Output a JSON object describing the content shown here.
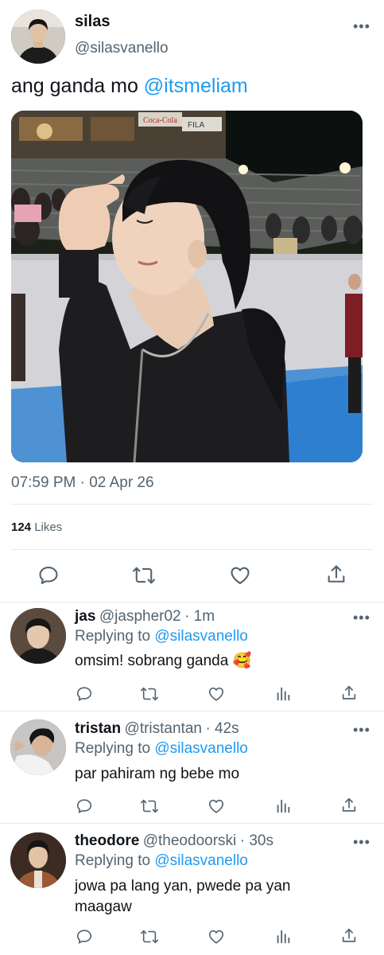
{
  "main_tweet": {
    "name": "silas",
    "handle": "@silasvanello",
    "text_prefix": "ang ganda mo ",
    "mention": "@itsmeliam",
    "time": "07:59 PM · 02 Apr 26",
    "likes_count": "124",
    "likes_label": "Likes",
    "photo_signs": {
      "sign_a": "Coca-Cola",
      "sign_b": "FILA"
    }
  },
  "replies": [
    {
      "name": "jas",
      "handle": "@jaspher02",
      "time": "· 1m",
      "replying_label": "Replying to ",
      "replying_to": "@silasvanello",
      "text": "omsim! sobrang ganda",
      "emoji": "🥰"
    },
    {
      "name": "tristan",
      "handle": "@tristantan",
      "time": "· 42s",
      "replying_label": "Replying to ",
      "replying_to": "@silasvanello",
      "text": "par pahiram ng bebe mo"
    },
    {
      "name": "theodore",
      "handle": "@theodoorski",
      "time": "· 30s",
      "replying_label": "Replying to ",
      "replying_to": "@silasvanello",
      "text_line1": "jowa pa lang yan, pwede pa yan",
      "text_line2": "maagaw"
    }
  ],
  "icons": {
    "reply": "reply-icon",
    "retweet": "retweet-icon",
    "like": "like-icon",
    "share": "share-icon",
    "analytics": "analytics-icon",
    "more": "more-icon"
  },
  "colors": {
    "link": "#1d9bf0",
    "secondary_text": "#536471",
    "divider": "#e6e9ec"
  }
}
